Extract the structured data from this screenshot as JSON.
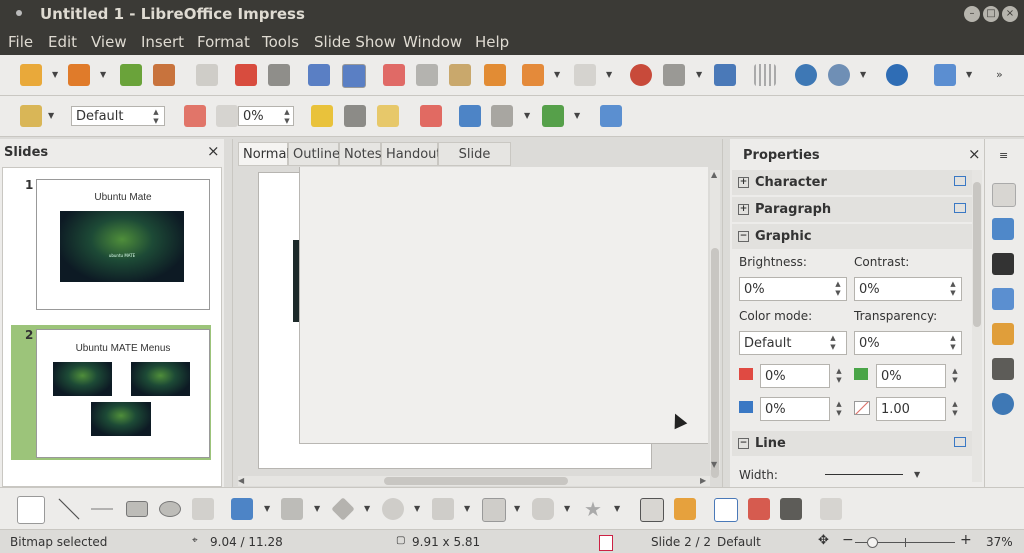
{
  "window": {
    "title": "Untitled 1 - LibreOffice Impress"
  },
  "menu": [
    "File",
    "Edit",
    "View",
    "Insert",
    "Format",
    "Tools",
    "Slide Show",
    "Window",
    "Help"
  ],
  "toolbar2": {
    "style_value": "Default",
    "rotation_value": "0%"
  },
  "slides_pane": {
    "title": "Slides",
    "close": "×",
    "slides": [
      {
        "number": "1",
        "title": "Ubuntu Mate",
        "caption": "ubuntu MATE"
      },
      {
        "number": "2",
        "title": "Ubuntu MATE Menus"
      }
    ]
  },
  "view_tabs": [
    "Normal",
    "Outline",
    "Notes",
    "Handout",
    "Slide Sorter"
  ],
  "properties": {
    "title": "Properties",
    "close": "×",
    "sections": {
      "character": "Character",
      "paragraph": "Paragraph",
      "graphic": "Graphic",
      "line": "Line"
    },
    "brightness_label": "Brightness:",
    "brightness_value": "0%",
    "contrast_label": "Contrast:",
    "contrast_value": "0%",
    "color_mode_label": "Color mode:",
    "color_mode_value": "Default",
    "transparency_label": "Transparency:",
    "transparency_value": "0%",
    "red_value": "0%",
    "green_value": "0%",
    "blue_value": "0%",
    "gamma_value": "1.00",
    "width_label": "Width:"
  },
  "statusbar": {
    "status": "Bitmap selected",
    "position": "9.04 / 11.28",
    "size": "9.91 x 5.81",
    "slide": "Slide 2 / 2",
    "master": "Default",
    "zoom": "37%"
  },
  "colors": {
    "titlebar": "#3b3a36",
    "menu_text": "#dfdbd2",
    "accent_green": "#9cc47a"
  }
}
